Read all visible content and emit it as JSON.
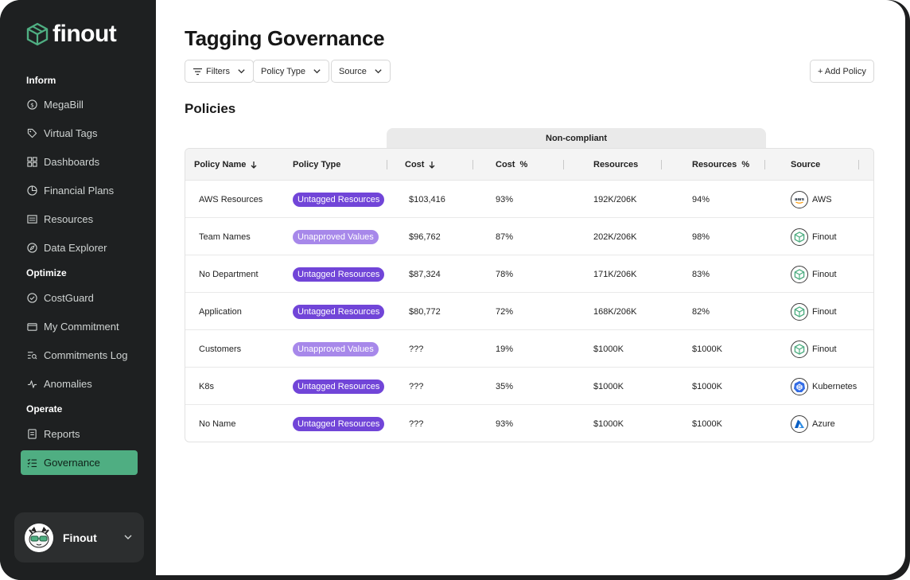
{
  "brand": {
    "name": "finout",
    "accent": "#4fae82"
  },
  "sidebar": {
    "sections": [
      {
        "label": "Inform",
        "items": [
          {
            "label": "MegaBill",
            "icon": "dollar-circle-icon"
          },
          {
            "label": "Virtual Tags",
            "icon": "tag-icon"
          },
          {
            "label": "Dashboards",
            "icon": "grid-icon"
          },
          {
            "label": "Financial Plans",
            "icon": "pie-chart-icon"
          },
          {
            "label": "Resources",
            "icon": "list-box-icon"
          },
          {
            "label": "Data Explorer",
            "icon": "compass-icon"
          }
        ]
      },
      {
        "label": "Optimize",
        "items": [
          {
            "label": "CostGuard",
            "icon": "shield-check-icon"
          },
          {
            "label": "My Commitment",
            "icon": "wallet-icon"
          },
          {
            "label": "Commitments Log",
            "icon": "log-search-icon"
          },
          {
            "label": "Anomalies",
            "icon": "pulse-icon"
          }
        ]
      },
      {
        "label": "Operate",
        "items": [
          {
            "label": "Reports",
            "icon": "report-icon"
          },
          {
            "label": "Governance",
            "icon": "checklist-icon",
            "active": true
          }
        ]
      }
    ],
    "org": {
      "name": "Finout"
    }
  },
  "page": {
    "title": "Tagging Governance",
    "filters": {
      "filters_label": "Filters",
      "policy_type_label": "Policy Type",
      "source_label": "Source"
    },
    "add_policy_label": "+ Add Policy",
    "section_title": "Policies"
  },
  "table": {
    "group_header": "Non-compliant",
    "columns": {
      "policy_name": "Policy Name",
      "policy_type": "Policy Type",
      "cost": "Cost",
      "cost_pct": "Cost  %",
      "resources": "Resources",
      "resources_pct": "Resources  %",
      "source": "Source"
    },
    "badge_colors": {
      "Untagged Resources": "#7145d8",
      "Unapproved Values": "#a788ea"
    },
    "rows": [
      {
        "name": "AWS Resources",
        "type": "Untagged Resources",
        "cost": "$103,416",
        "cost_pct": "93%",
        "resources": "192K/206K",
        "resources_pct": "94%",
        "source": "AWS",
        "source_icon": "aws-icon"
      },
      {
        "name": "Team Names",
        "type": "Unapproved Values",
        "cost": "$96,762",
        "cost_pct": "87%",
        "resources": "202K/206K",
        "resources_pct": "98%",
        "source": "Finout",
        "source_icon": "finout-icon"
      },
      {
        "name": "No Department",
        "type": "Untagged Resources",
        "cost": "$87,324",
        "cost_pct": "78%",
        "resources": "171K/206K",
        "resources_pct": "83%",
        "source": "Finout",
        "source_icon": "finout-icon"
      },
      {
        "name": "Application",
        "type": "Untagged Resources",
        "cost": "$80,772",
        "cost_pct": "72%",
        "resources": "168K/206K",
        "resources_pct": "82%",
        "source": "Finout",
        "source_icon": "finout-icon"
      },
      {
        "name": "Customers",
        "type": "Unapproved Values",
        "cost": "???",
        "cost_pct": "19%",
        "resources": "$1000K",
        "resources_pct": "$1000K",
        "source": "Finout",
        "source_icon": "finout-icon"
      },
      {
        "name": "K8s",
        "type": "Untagged Resources",
        "cost": "???",
        "cost_pct": "35%",
        "resources": "$1000K",
        "resources_pct": "$1000K",
        "source": "Kubernetes",
        "source_icon": "kubernetes-icon"
      },
      {
        "name": "No Name",
        "type": "Untagged Resources",
        "cost": "???",
        "cost_pct": "93%",
        "resources": "$1000K",
        "resources_pct": "$1000K",
        "source": "Azure",
        "source_icon": "azure-icon"
      }
    ]
  }
}
